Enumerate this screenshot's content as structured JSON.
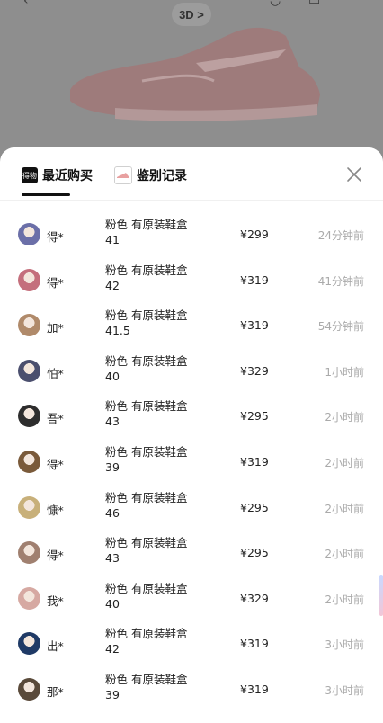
{
  "header": {
    "view3d_label": "3D >"
  },
  "sheet": {
    "tabs": [
      {
        "label": "最近购买",
        "icon": "dewu-logo-icon",
        "icon_text": "得物",
        "active": true
      },
      {
        "label": "鉴别记录",
        "icon": "shoe-thumbnail-icon",
        "active": false
      }
    ],
    "close_icon": "close-icon"
  },
  "purchases": [
    {
      "user": "得*",
      "spec_line1": "粉色 有原装鞋盒",
      "size": "41",
      "price": "¥299",
      "time": "24分钟前",
      "avatar_color": "#6b6fa8"
    },
    {
      "user": "得*",
      "spec_line1": "粉色 有原装鞋盒",
      "size": "42",
      "price": "¥319",
      "time": "41分钟前",
      "avatar_color": "#c46f7c"
    },
    {
      "user": "加*",
      "spec_line1": "粉色 有原装鞋盒",
      "size": "41.5",
      "price": "¥319",
      "time": "54分钟前",
      "avatar_color": "#b08a6a"
    },
    {
      "user": "怕*",
      "spec_line1": "粉色 有原装鞋盒",
      "size": "40",
      "price": "¥329",
      "time": "1小时前",
      "avatar_color": "#4b4f6e"
    },
    {
      "user": "吾*",
      "spec_line1": "粉色 有原装鞋盒",
      "size": "43",
      "price": "¥295",
      "time": "2小时前",
      "avatar_color": "#2d2d2d"
    },
    {
      "user": "得*",
      "spec_line1": "粉色 有原装鞋盒",
      "size": "39",
      "price": "¥319",
      "time": "2小时前",
      "avatar_color": "#7a5a3a"
    },
    {
      "user": "慷*",
      "spec_line1": "粉色 有原装鞋盒",
      "size": "46",
      "price": "¥295",
      "time": "2小时前",
      "avatar_color": "#c8b07a"
    },
    {
      "user": "得*",
      "spec_line1": "粉色 有原装鞋盒",
      "size": "43",
      "price": "¥295",
      "time": "2小时前",
      "avatar_color": "#a08070"
    },
    {
      "user": "我*",
      "spec_line1": "粉色 有原装鞋盒",
      "size": "40",
      "price": "¥329",
      "time": "2小时前",
      "avatar_color": "#d6a9a2"
    },
    {
      "user": "出*",
      "spec_line1": "粉色 有原装鞋盒",
      "size": "42",
      "price": "¥319",
      "time": "3小时前",
      "avatar_color": "#1f3a66"
    },
    {
      "user": "那*",
      "spec_line1": "粉色 有原装鞋盒",
      "size": "39",
      "price": "¥319",
      "time": "3小时前",
      "avatar_color": "#5a4a3a"
    }
  ]
}
